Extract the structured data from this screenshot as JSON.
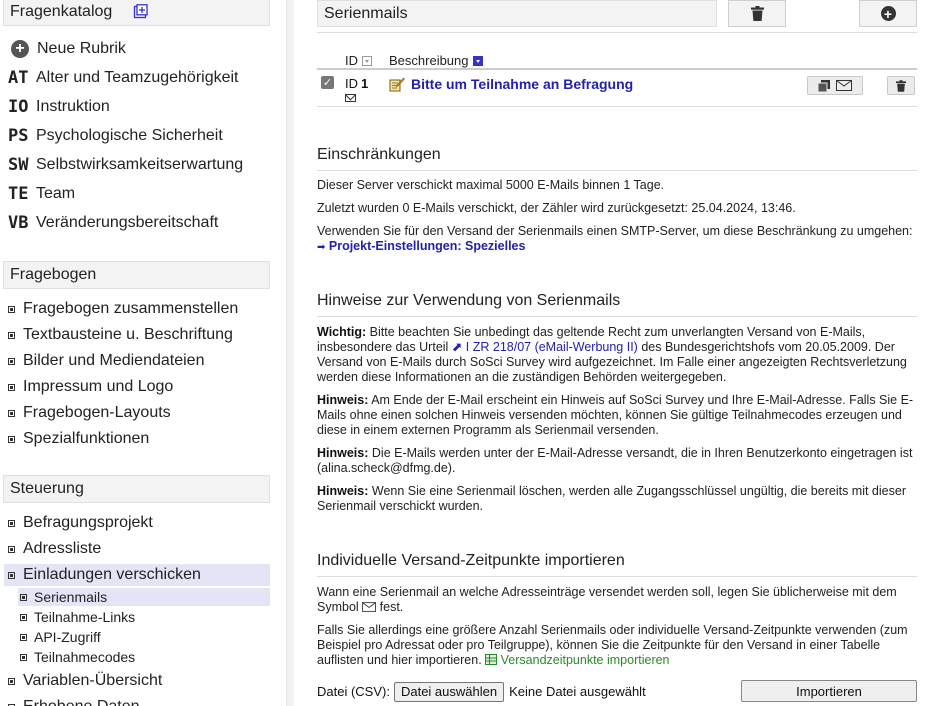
{
  "sidebar": {
    "catalog": {
      "title": "Fragenkatalog",
      "items": [
        {
          "code": "",
          "label": "Neue Rubrik"
        },
        {
          "code": "AT",
          "label": "Alter und Teamzugehörigkeit"
        },
        {
          "code": "IO",
          "label": "Instruktion"
        },
        {
          "code": "PS",
          "label": "Psychologische Sicherheit"
        },
        {
          "code": "SW",
          "label": "Selbstwirksamkeitserwartung"
        },
        {
          "code": "TE",
          "label": "Team"
        },
        {
          "code": "VB",
          "label": "Veränderungsbereitschaft"
        }
      ]
    },
    "questionnaire": {
      "title": "Fragebogen",
      "items": [
        "Fragebogen zusammenstellen",
        "Textbausteine u. Beschriftung",
        "Bilder und Mediendateien",
        "Impressum und Logo",
        "Fragebogen-Layouts",
        "Spezialfunktionen"
      ]
    },
    "control": {
      "title": "Steuerung",
      "items": [
        "Befragungsprojekt",
        "Adressliste",
        "Einladungen verschicken"
      ],
      "subitems": [
        "Serienmails",
        "Teilnahme-Links",
        "API-Zugriff",
        "Teilnahmecodes"
      ],
      "after": [
        "Variablen-Übersicht",
        "Erhobene Daten"
      ]
    }
  },
  "main": {
    "title": "Serienmails",
    "table": {
      "col_id": "ID",
      "col_desc": "Beschreibung",
      "row": {
        "id_label": "ID",
        "id": "1",
        "description": "Bitte um Teilnahme an Befragung"
      }
    },
    "restrictions": {
      "heading": "Einschränkungen",
      "p1": "Dieser Server verschickt maximal 5000 E-Mails binnen 1 Tage.",
      "p2": "Zuletzt wurden 0 E-Mails verschickt, der Zähler wird zurückgesetzt: 25.04.2024, 13:46.",
      "p3_a": "Verwenden Sie für den Versand der Serienmails einen SMTP-Server, um diese Beschränkung zu umgehen:",
      "p3_link": "Projekt-Einstellungen: Spezielles"
    },
    "notes": {
      "heading": "Hinweise zur Verwendung von Serienmails",
      "n1_label": "Wichtig:",
      "n1_a": "Bitte beachten Sie unbedingt das geltende Recht zum unverlangten Versand von E-Mails, insbesondere das Urteil",
      "n1_link": "I ZR 218/07 (eMail-Werbung II)",
      "n1_b": "des Bundesgerichtshofs vom 20.05.2009. Der Versand von E-Mails durch SoSci Survey wird aufgezeichnet. Im Falle einer angezeigten Rechtsverletzung werden diese Informationen an die zuständigen Behörden weitergegeben.",
      "n2_label": "Hinweis:",
      "n2": "Am Ende der E-Mail erscheint ein Hinweis auf SoSci Survey und Ihre E-Mail-Adresse. Falls Sie E-Mails ohne einen solchen Hinweis versenden möchten, können Sie gültige Teilnahmecodes erzeugen und diese in einem externen Programm als Serienmail versenden.",
      "n3_label": "Hinweis:",
      "n3": "Die E-Mails werden unter der E-Mail-Adresse versandt, die in Ihren Benutzerkonto eingetragen ist (alina.scheck@dfmg.de).",
      "n4_label": "Hinweis:",
      "n4": "Wenn Sie eine Serienmail löschen, werden alle Zugangsschlüssel ungültig, die bereits mit dieser Serienmail verschickt wurden."
    },
    "import": {
      "heading": "Individuelle Versand-Zeitpunkte importieren",
      "p1_a": "Wann eine Serienmail an welche Adresseinträge versendet werden soll, legen Sie üblicherweise mit dem Symbol",
      "p1_b": "fest.",
      "p2": "Falls Sie allerdings eine größere Anzahl Serienmails oder individuelle Versand-Zeitpunkte verwenden (zum Beispiel pro Adressat oder pro Teilgruppe), können Sie die Zeitpunkte für den Versand in einer Tabelle auflisten und hier importieren.",
      "p2_link": "Versandzeitpunkte importieren",
      "file_label": "Datei (CSV):",
      "file_button": "Datei auswählen",
      "file_status": "Keine Datei ausgewählt",
      "import_button": "Importieren"
    }
  }
}
